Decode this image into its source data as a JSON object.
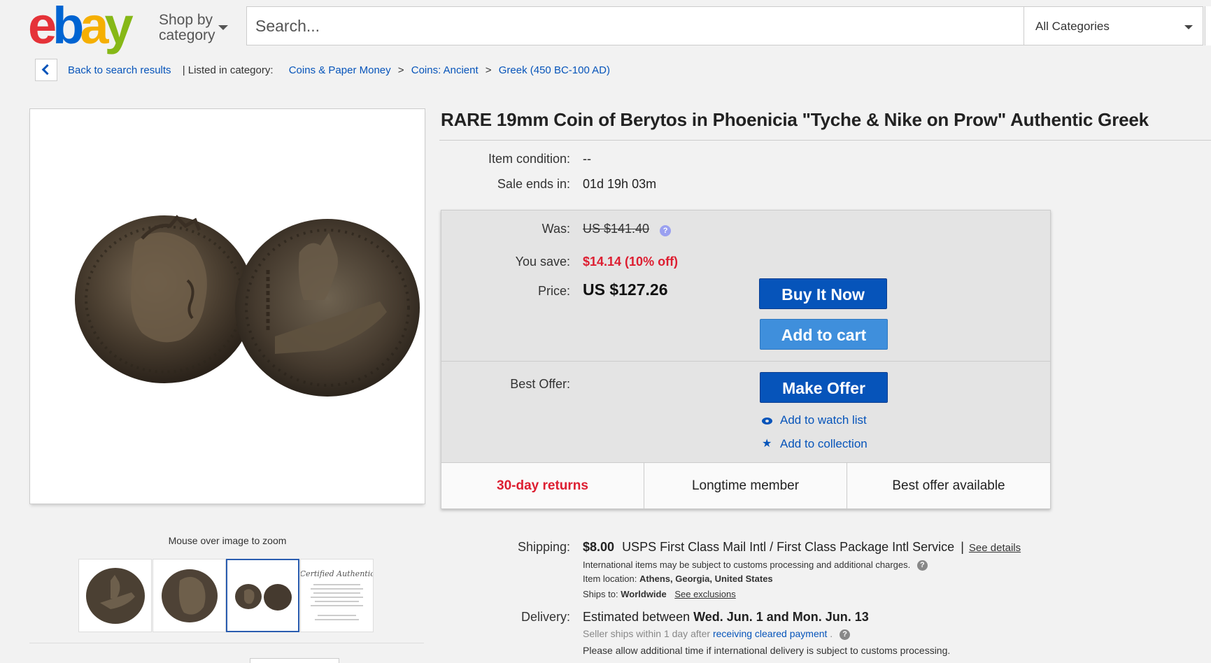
{
  "header": {
    "logo_letters": [
      "e",
      "b",
      "a",
      "y"
    ],
    "shop_by_line1": "Shop by",
    "shop_by_line2": "category",
    "search_placeholder": "Search...",
    "category_selected": "All Categories"
  },
  "breadcrumb": {
    "back_label": "Back to search results",
    "listed_in": "| Listed in category:",
    "items": [
      "Coins & Paper Money",
      "Coins: Ancient",
      "Greek (450 BC-100 AD)"
    ],
    "separator": ">"
  },
  "gallery": {
    "zoom_hint": "Mouse over image to zoom",
    "thumbnails": [
      "thumb-coin-reverse",
      "thumb-coin-obverse",
      "thumb-both-coins",
      "thumb-certificate"
    ],
    "selected_thumbnail": 2,
    "certificate_text": "Certified Authentic"
  },
  "item": {
    "title": "RARE 19mm Coin of Berytos in Phoenicia \"Tyche & Nike on Prow\" Authentic Greek",
    "condition_label": "Item condition:",
    "condition_value": "--",
    "sale_ends_label": "Sale ends in:",
    "sale_ends_value": "01d 19h 03m"
  },
  "pricing": {
    "was_label": "Was:",
    "was_value": "US $141.40",
    "save_label": "You save:",
    "save_value": "$14.14 (10% off)",
    "price_label": "Price:",
    "price_value": "US $127.26",
    "buy_now": "Buy It Now",
    "add_to_cart": "Add to cart",
    "best_offer_label": "Best Offer:",
    "make_offer": "Make Offer",
    "watch_list": "Add to watch list",
    "collection": "Add to collection",
    "features": [
      "30-day returns",
      "Longtime member",
      "Best offer available"
    ]
  },
  "shipping": {
    "label": "Shipping:",
    "cost": "$8.00",
    "service": "USPS First Class Mail Intl / First Class Package Intl Service",
    "separator": "|",
    "see_details": "See details",
    "intl_note": "International items may be subject to customs processing and additional charges.",
    "location_label": "Item location:",
    "location_value": "Athens, Georgia, United States",
    "ships_to_label": "Ships to:",
    "ships_to_value": "Worldwide",
    "see_exclusions": "See exclusions"
  },
  "delivery": {
    "label": "Delivery:",
    "estimate_prefix": "Estimated between",
    "estimate_dates": "Wed. Jun. 1 and Mon. Jun. 13",
    "handling_prefix": "Seller ships within 1 day after",
    "handling_link": "receiving cleared payment",
    "handling_suffix": ".",
    "customs_note": "Please allow additional time if international delivery is subject to customs processing."
  },
  "colors": {
    "ebay_red": "#e53238",
    "ebay_blue": "#0064d2",
    "ebay_yellow": "#f5af02",
    "ebay_green": "#86b817",
    "button_blue": "#0654ba",
    "sale_red": "#dd1e31"
  }
}
